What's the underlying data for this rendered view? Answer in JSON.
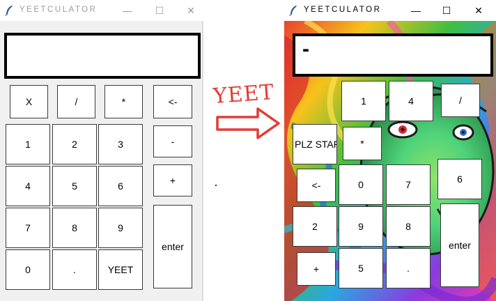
{
  "left_window": {
    "title": "YEETCULATOR",
    "display_value": "",
    "keys": {
      "x": "X",
      "div": "/",
      "mul": "*",
      "back": "<-",
      "k1": "1",
      "k2": "2",
      "k3": "3",
      "minus": "-",
      "k4": "4",
      "k5": "5",
      "k6": "6",
      "plus": "+",
      "k7": "7",
      "k8": "8",
      "k9": "9",
      "enter": "enter",
      "k0": "0",
      "dot": ".",
      "yeet": "YEET"
    }
  },
  "annotation": {
    "text": "YEET"
  },
  "right_window": {
    "title": "YEETCULATOR",
    "display_value": "-",
    "keys": {
      "k1": "1",
      "k4": "4",
      "div": "/",
      "plz": "PLZ STAPH",
      "mul": "*",
      "back": "<-",
      "k0": "0",
      "k7": "7",
      "k6": "6",
      "k2": "2",
      "k9": "9",
      "k8": "8",
      "enter": "enter",
      "plus": "+",
      "k5": "5",
      "dot": "."
    }
  },
  "window_controls": {
    "minimize": "—",
    "maximize": "☐",
    "close": "✕"
  },
  "colors": {
    "accent_red": "#e53935"
  }
}
